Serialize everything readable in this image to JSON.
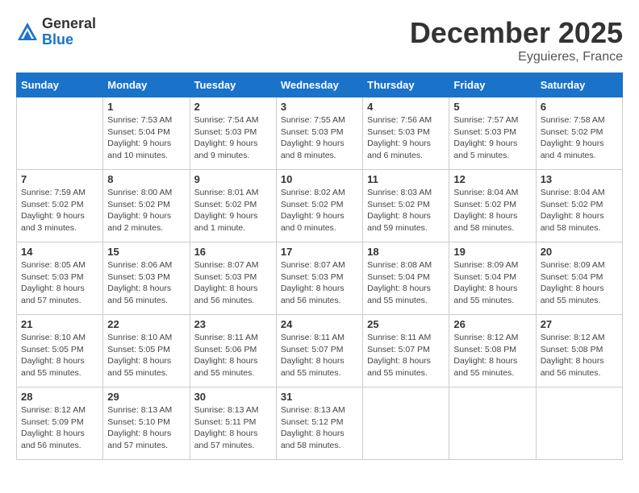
{
  "logo": {
    "general": "General",
    "blue": "Blue"
  },
  "header": {
    "month": "December 2025",
    "location": "Eyguieres, France"
  },
  "days_of_week": [
    "Sunday",
    "Monday",
    "Tuesday",
    "Wednesday",
    "Thursday",
    "Friday",
    "Saturday"
  ],
  "weeks": [
    [
      {
        "day": "",
        "sunrise": "",
        "sunset": "",
        "daylight": ""
      },
      {
        "day": "1",
        "sunrise": "Sunrise: 7:53 AM",
        "sunset": "Sunset: 5:04 PM",
        "daylight": "Daylight: 9 hours and 10 minutes."
      },
      {
        "day": "2",
        "sunrise": "Sunrise: 7:54 AM",
        "sunset": "Sunset: 5:03 PM",
        "daylight": "Daylight: 9 hours and 9 minutes."
      },
      {
        "day": "3",
        "sunrise": "Sunrise: 7:55 AM",
        "sunset": "Sunset: 5:03 PM",
        "daylight": "Daylight: 9 hours and 8 minutes."
      },
      {
        "day": "4",
        "sunrise": "Sunrise: 7:56 AM",
        "sunset": "Sunset: 5:03 PM",
        "daylight": "Daylight: 9 hours and 6 minutes."
      },
      {
        "day": "5",
        "sunrise": "Sunrise: 7:57 AM",
        "sunset": "Sunset: 5:03 PM",
        "daylight": "Daylight: 9 hours and 5 minutes."
      },
      {
        "day": "6",
        "sunrise": "Sunrise: 7:58 AM",
        "sunset": "Sunset: 5:02 PM",
        "daylight": "Daylight: 9 hours and 4 minutes."
      }
    ],
    [
      {
        "day": "7",
        "sunrise": "Sunrise: 7:59 AM",
        "sunset": "Sunset: 5:02 PM",
        "daylight": "Daylight: 9 hours and 3 minutes."
      },
      {
        "day": "8",
        "sunrise": "Sunrise: 8:00 AM",
        "sunset": "Sunset: 5:02 PM",
        "daylight": "Daylight: 9 hours and 2 minutes."
      },
      {
        "day": "9",
        "sunrise": "Sunrise: 8:01 AM",
        "sunset": "Sunset: 5:02 PM",
        "daylight": "Daylight: 9 hours and 1 minute."
      },
      {
        "day": "10",
        "sunrise": "Sunrise: 8:02 AM",
        "sunset": "Sunset: 5:02 PM",
        "daylight": "Daylight: 9 hours and 0 minutes."
      },
      {
        "day": "11",
        "sunrise": "Sunrise: 8:03 AM",
        "sunset": "Sunset: 5:02 PM",
        "daylight": "Daylight: 8 hours and 59 minutes."
      },
      {
        "day": "12",
        "sunrise": "Sunrise: 8:04 AM",
        "sunset": "Sunset: 5:02 PM",
        "daylight": "Daylight: 8 hours and 58 minutes."
      },
      {
        "day": "13",
        "sunrise": "Sunrise: 8:04 AM",
        "sunset": "Sunset: 5:02 PM",
        "daylight": "Daylight: 8 hours and 58 minutes."
      }
    ],
    [
      {
        "day": "14",
        "sunrise": "Sunrise: 8:05 AM",
        "sunset": "Sunset: 5:03 PM",
        "daylight": "Daylight: 8 hours and 57 minutes."
      },
      {
        "day": "15",
        "sunrise": "Sunrise: 8:06 AM",
        "sunset": "Sunset: 5:03 PM",
        "daylight": "Daylight: 8 hours and 56 minutes."
      },
      {
        "day": "16",
        "sunrise": "Sunrise: 8:07 AM",
        "sunset": "Sunset: 5:03 PM",
        "daylight": "Daylight: 8 hours and 56 minutes."
      },
      {
        "day": "17",
        "sunrise": "Sunrise: 8:07 AM",
        "sunset": "Sunset: 5:03 PM",
        "daylight": "Daylight: 8 hours and 56 minutes."
      },
      {
        "day": "18",
        "sunrise": "Sunrise: 8:08 AM",
        "sunset": "Sunset: 5:04 PM",
        "daylight": "Daylight: 8 hours and 55 minutes."
      },
      {
        "day": "19",
        "sunrise": "Sunrise: 8:09 AM",
        "sunset": "Sunset: 5:04 PM",
        "daylight": "Daylight: 8 hours and 55 minutes."
      },
      {
        "day": "20",
        "sunrise": "Sunrise: 8:09 AM",
        "sunset": "Sunset: 5:04 PM",
        "daylight": "Daylight: 8 hours and 55 minutes."
      }
    ],
    [
      {
        "day": "21",
        "sunrise": "Sunrise: 8:10 AM",
        "sunset": "Sunset: 5:05 PM",
        "daylight": "Daylight: 8 hours and 55 minutes."
      },
      {
        "day": "22",
        "sunrise": "Sunrise: 8:10 AM",
        "sunset": "Sunset: 5:05 PM",
        "daylight": "Daylight: 8 hours and 55 minutes."
      },
      {
        "day": "23",
        "sunrise": "Sunrise: 8:11 AM",
        "sunset": "Sunset: 5:06 PM",
        "daylight": "Daylight: 8 hours and 55 minutes."
      },
      {
        "day": "24",
        "sunrise": "Sunrise: 8:11 AM",
        "sunset": "Sunset: 5:07 PM",
        "daylight": "Daylight: 8 hours and 55 minutes."
      },
      {
        "day": "25",
        "sunrise": "Sunrise: 8:11 AM",
        "sunset": "Sunset: 5:07 PM",
        "daylight": "Daylight: 8 hours and 55 minutes."
      },
      {
        "day": "26",
        "sunrise": "Sunrise: 8:12 AM",
        "sunset": "Sunset: 5:08 PM",
        "daylight": "Daylight: 8 hours and 55 minutes."
      },
      {
        "day": "27",
        "sunrise": "Sunrise: 8:12 AM",
        "sunset": "Sunset: 5:08 PM",
        "daylight": "Daylight: 8 hours and 56 minutes."
      }
    ],
    [
      {
        "day": "28",
        "sunrise": "Sunrise: 8:12 AM",
        "sunset": "Sunset: 5:09 PM",
        "daylight": "Daylight: 8 hours and 56 minutes."
      },
      {
        "day": "29",
        "sunrise": "Sunrise: 8:13 AM",
        "sunset": "Sunset: 5:10 PM",
        "daylight": "Daylight: 8 hours and 57 minutes."
      },
      {
        "day": "30",
        "sunrise": "Sunrise: 8:13 AM",
        "sunset": "Sunset: 5:11 PM",
        "daylight": "Daylight: 8 hours and 57 minutes."
      },
      {
        "day": "31",
        "sunrise": "Sunrise: 8:13 AM",
        "sunset": "Sunset: 5:12 PM",
        "daylight": "Daylight: 8 hours and 58 minutes."
      },
      {
        "day": "",
        "sunrise": "",
        "sunset": "",
        "daylight": ""
      },
      {
        "day": "",
        "sunrise": "",
        "sunset": "",
        "daylight": ""
      },
      {
        "day": "",
        "sunrise": "",
        "sunset": "",
        "daylight": ""
      }
    ]
  ]
}
